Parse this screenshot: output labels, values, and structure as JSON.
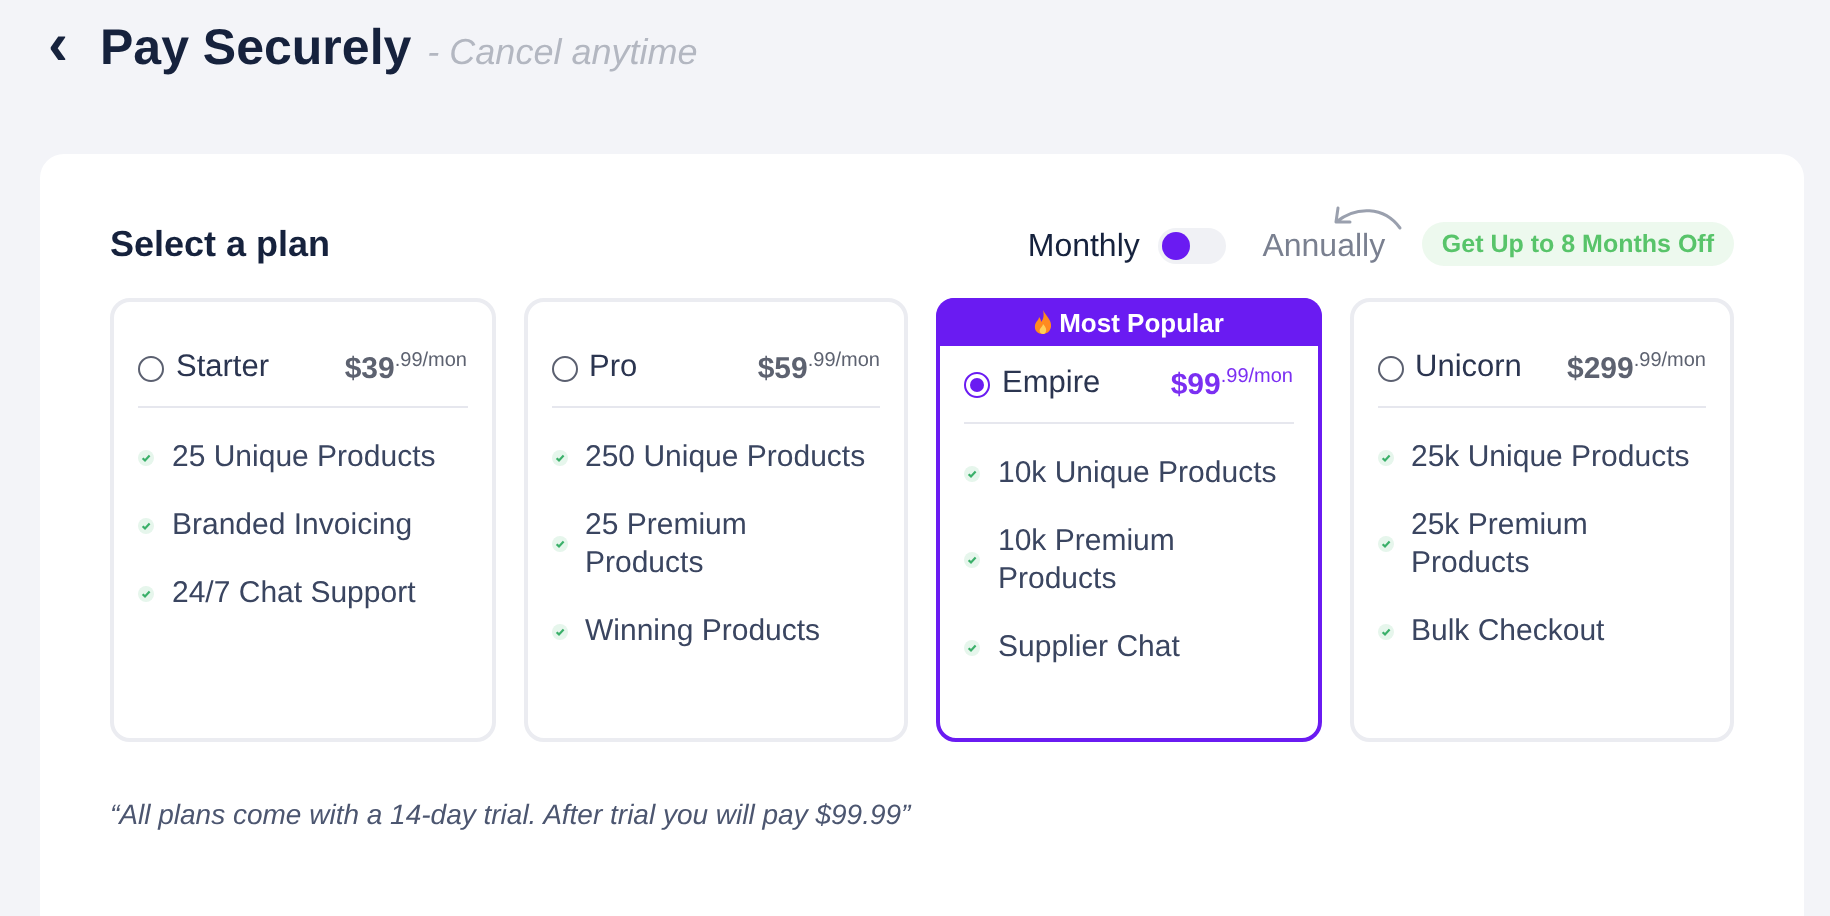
{
  "header": {
    "back": "‹",
    "title": "Pay Securely",
    "subtitle": "- Cancel anytime"
  },
  "section_title": "Select a plan",
  "billing": {
    "left_label": "Monthly",
    "right_label": "Annually",
    "annual": false,
    "promo": "Get Up to 8 Months Off"
  },
  "plans": [
    {
      "name": "Starter",
      "price": "$39",
      "cents": ".99/mon",
      "selected": false,
      "features": [
        "25 Unique Products",
        "Branded Invoicing",
        "24/7 Chat Support"
      ]
    },
    {
      "name": "Pro",
      "price": "$59",
      "cents": ".99/mon",
      "selected": false,
      "features": [
        "250 Unique Products",
        "25 Premium Products",
        "Winning Products"
      ]
    },
    {
      "name": "Empire",
      "price": "$99",
      "cents": ".99/mon",
      "selected": true,
      "badge": "Most Popular",
      "features": [
        "10k Unique Products",
        "10k Premium Products",
        "Supplier Chat"
      ]
    },
    {
      "name": "Unicorn",
      "price": "$299",
      "cents": ".99/mon",
      "selected": false,
      "features": [
        "25k Unique Products",
        "25k Premium Products",
        "Bulk Checkout"
      ]
    }
  ],
  "note": "“All plans come with a 14-day trial. After trial you will pay $99.99”"
}
